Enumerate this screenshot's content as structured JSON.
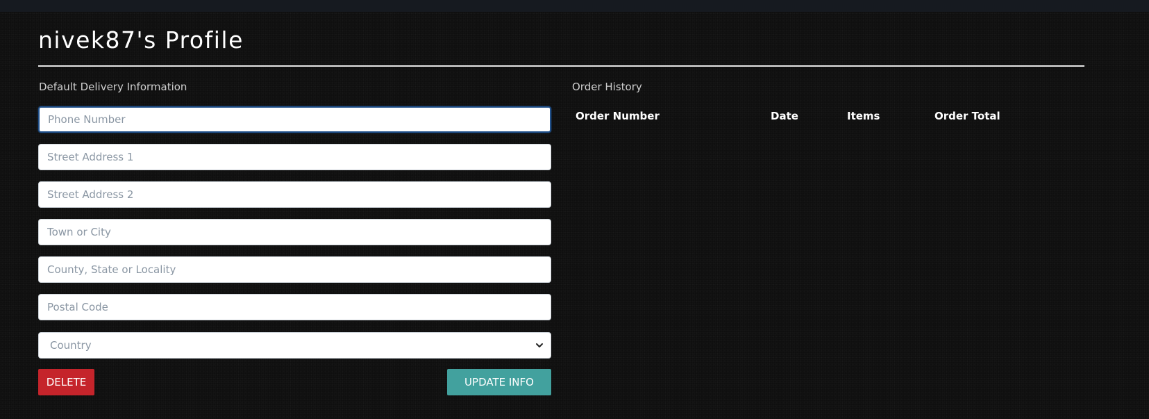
{
  "profile": {
    "title": "nivek87's Profile"
  },
  "delivery": {
    "section_label": "Default Delivery Information",
    "fields": {
      "phone": {
        "placeholder": "Phone Number",
        "value": ""
      },
      "street1": {
        "placeholder": "Street Address 1",
        "value": ""
      },
      "street2": {
        "placeholder": "Street Address 2",
        "value": ""
      },
      "town": {
        "placeholder": "Town or City",
        "value": ""
      },
      "county": {
        "placeholder": "County, State or Locality",
        "value": ""
      },
      "postcode": {
        "placeholder": "Postal Code",
        "value": ""
      }
    },
    "country": {
      "selected": "Country",
      "icon": "chevron-down-icon"
    },
    "delete_label": "DELETE",
    "update_label": "UPDATE INFO"
  },
  "orders": {
    "section_label": "Order History",
    "columns": [
      "Order Number",
      "Date",
      "Items",
      "Order Total"
    ],
    "rows": []
  },
  "colors": {
    "background": "#0f0f0f",
    "delete_button": "#c5242b",
    "update_button": "#42a19e",
    "focus_border": "#1f4f8a"
  }
}
